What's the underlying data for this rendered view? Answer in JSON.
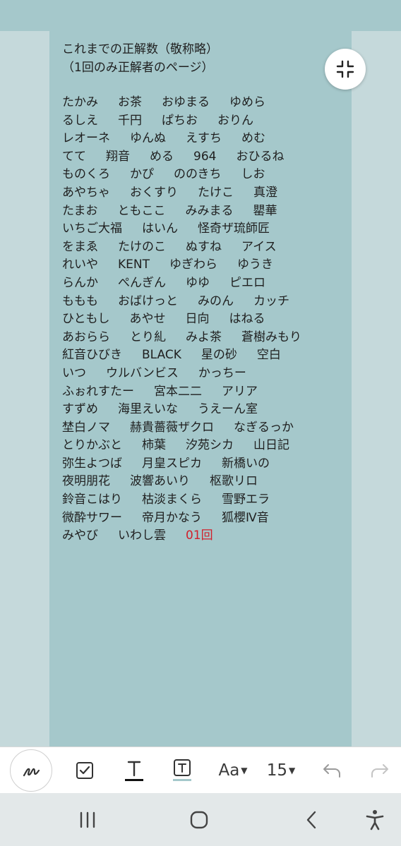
{
  "note": {
    "title": "これまでの正解数（敬称略）",
    "subtitle": "（1回のみ正解者のページ）",
    "rows": [
      [
        "たかみ",
        "お茶",
        "おゆまる",
        "ゆめら"
      ],
      [
        "るしえ",
        "千円",
        "ぱちお",
        "おりん"
      ],
      [
        "レオーネ",
        "ゆんぬ",
        "えすち",
        "めむ"
      ],
      [
        "てて",
        "翔音",
        "める",
        "964",
        "おひるね"
      ],
      [
        "ものくろ",
        "かぴ",
        "ののきち",
        "しお"
      ],
      [
        "あやちゃ",
        "おくすり",
        "たけこ",
        "真澄"
      ],
      [
        "たまお",
        "ともここ",
        "みみまる",
        "罌華"
      ],
      [
        "いちご大福",
        "はいん",
        "怪奇ザ琉師匠"
      ],
      [
        "をまゑ",
        "たけのこ",
        "ぬすね",
        "アイス"
      ],
      [
        "れいや",
        "KENT",
        "ゆぎわら",
        "ゆうき"
      ],
      [
        "らんか",
        "ぺんぎん",
        "ゆゆ",
        "ピエロ"
      ],
      [
        "ももも",
        "おばけっと",
        "みのん",
        "カッチ"
      ],
      [
        "ひともし",
        "あやせ",
        "日向",
        "はねる"
      ],
      [
        "あおらら",
        "とり糺",
        "みよ茶",
        "蒼樹みもり"
      ],
      [
        "紅音ひびき",
        "BLACK",
        "星の砂",
        "空白"
      ],
      [
        "いつ",
        "ウルバンビス",
        "かっちー"
      ],
      [
        "ふぉれすたー",
        "宮本二二",
        "アリア"
      ],
      [
        "すずめ",
        "海里えいな",
        "うえーん室"
      ],
      [
        "埜白ノマ",
        "赫貴薔薇ザクロ",
        "なぎるっか"
      ],
      [
        "とりかぶと",
        "柿葉",
        "汐苑シカ",
        "山日記"
      ],
      [
        "弥生よつば",
        "月皇スピカ",
        "新橋いの"
      ],
      [
        "夜明朋花",
        "波響あいり",
        "枢歌リロ"
      ],
      [
        "鈴音こはり",
        "枯淡まくら",
        "雪野エラ"
      ],
      [
        "微酔サワー",
        "帝月かなう",
        "狐櫻Ⅳ音"
      ],
      [
        "みやび",
        "いわし雲",
        "01回"
      ]
    ],
    "count_color": "#d1202b"
  },
  "toolbar": {
    "font_style_label": "Aa",
    "font_size_label": "15",
    "icons": [
      "pen-icon",
      "checkbox-icon",
      "text-color-icon",
      "text-background-icon",
      "font-style",
      "font-size",
      "undo-icon",
      "redo-icon"
    ]
  },
  "navbar": {
    "icons": [
      "recent-apps-icon",
      "home-icon",
      "back-icon",
      "accessibility-icon"
    ]
  },
  "colors": {
    "panel": "#a5c8cb",
    "margin": "#c5d9db",
    "toolbar_bg": "#ffffff",
    "navbar_bg": "#e3e8e9"
  }
}
